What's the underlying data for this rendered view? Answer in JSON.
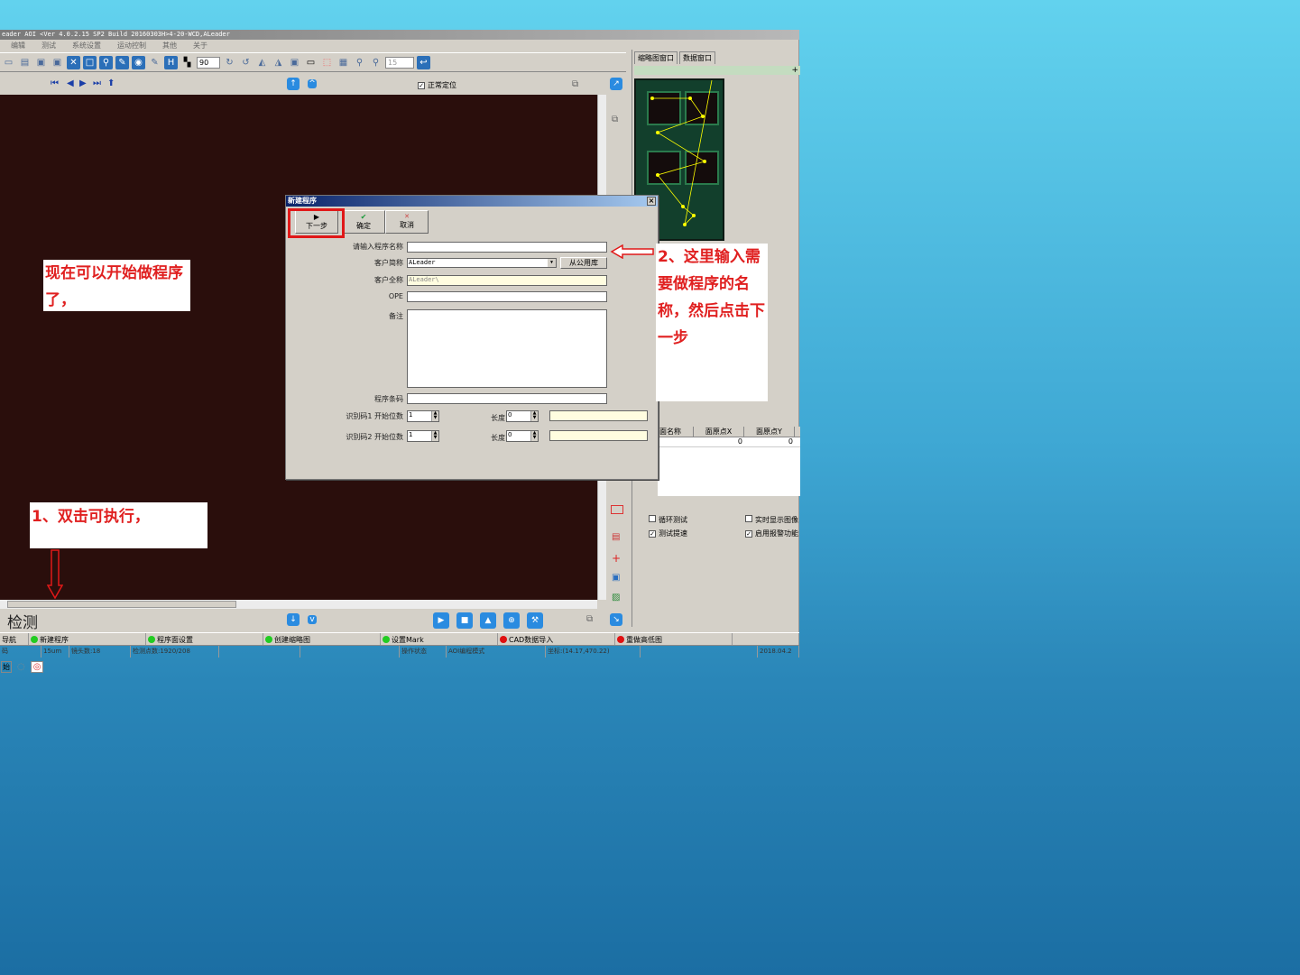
{
  "app": {
    "title": "eader AOI  <Ver 4.0.2.15 SP2 Build 20160303H>4-20-WCD,ALeader",
    "menu": [
      "编辑",
      "测试",
      "系统设置",
      "运动控制",
      "其他",
      "关于"
    ],
    "toolbar": {
      "zoom_value": "90",
      "step_value": "15"
    },
    "nav": {
      "normal_position_label": "正常定位",
      "normal_position_checked": true
    },
    "stage_label": "检测",
    "right_panel": {
      "tabs": [
        "缩略图窗口",
        "数据窗口"
      ],
      "plus": "+",
      "table": {
        "headers": [
          "面名称",
          "面原点X",
          "面原点Y"
        ],
        "rows": [
          [
            "",
            "0",
            "0"
          ]
        ]
      },
      "checkboxes": [
        {
          "label": "循环测试",
          "checked": false
        },
        {
          "label": "实时显示图像",
          "checked": false
        },
        {
          "label": "测试提速",
          "checked": true
        },
        {
          "label": "启用报警功能",
          "checked": true
        }
      ]
    },
    "steps": [
      {
        "label": "导航",
        "color": ""
      },
      {
        "label": "新建程序",
        "color": "#22cc22"
      },
      {
        "label": "程序面设置",
        "color": "#22cc22"
      },
      {
        "label": "创建缩略图",
        "color": "#22cc22"
      },
      {
        "label": "设置Mark",
        "color": "#22cc22"
      },
      {
        "label": "CAD数据导入",
        "color": "#e01010"
      },
      {
        "label": "重做高低图",
        "color": "#e01010"
      }
    ],
    "status": [
      "码",
      "15um",
      "镜头数:18",
      "检测点数:1920/208",
      "",
      "",
      "操作状态",
      "AOI编程模式",
      "坐标:(14.17,470.22)",
      "",
      "2018.04.2"
    ],
    "taskbar": [
      "始"
    ]
  },
  "dialog": {
    "title": "新建程序",
    "close": "×",
    "buttons": {
      "next": "下一步",
      "ok": "确定",
      "cancel": "取消"
    },
    "fields": {
      "program_name_label": "请输入程序名称",
      "program_name_value": "",
      "customer_short_label": "客户简称",
      "customer_short_value": "ALeader",
      "from_library_button": "从公用库",
      "customer_full_label": "客户全称",
      "customer_full_value": "ALeader\\",
      "ope_label": "OPE",
      "ope_value": "",
      "remark_label": "备注",
      "remark_value": "",
      "barcode_label": "程序条码",
      "barcode_value": "",
      "id1_label": "识别码1  开始位数",
      "id1_start": "1",
      "id1_len_label": "长度",
      "id1_len": "0",
      "id2_label": "识别码2  开始位数",
      "id2_start": "1",
      "id2_len_label": "长度",
      "id2_len": "0"
    }
  },
  "annotations": {
    "note1": "现在可以开始做程序了，",
    "note2": "1、双击可执行，",
    "note3": "2、这里输入需要做程序的名称，然后点击下一步"
  }
}
